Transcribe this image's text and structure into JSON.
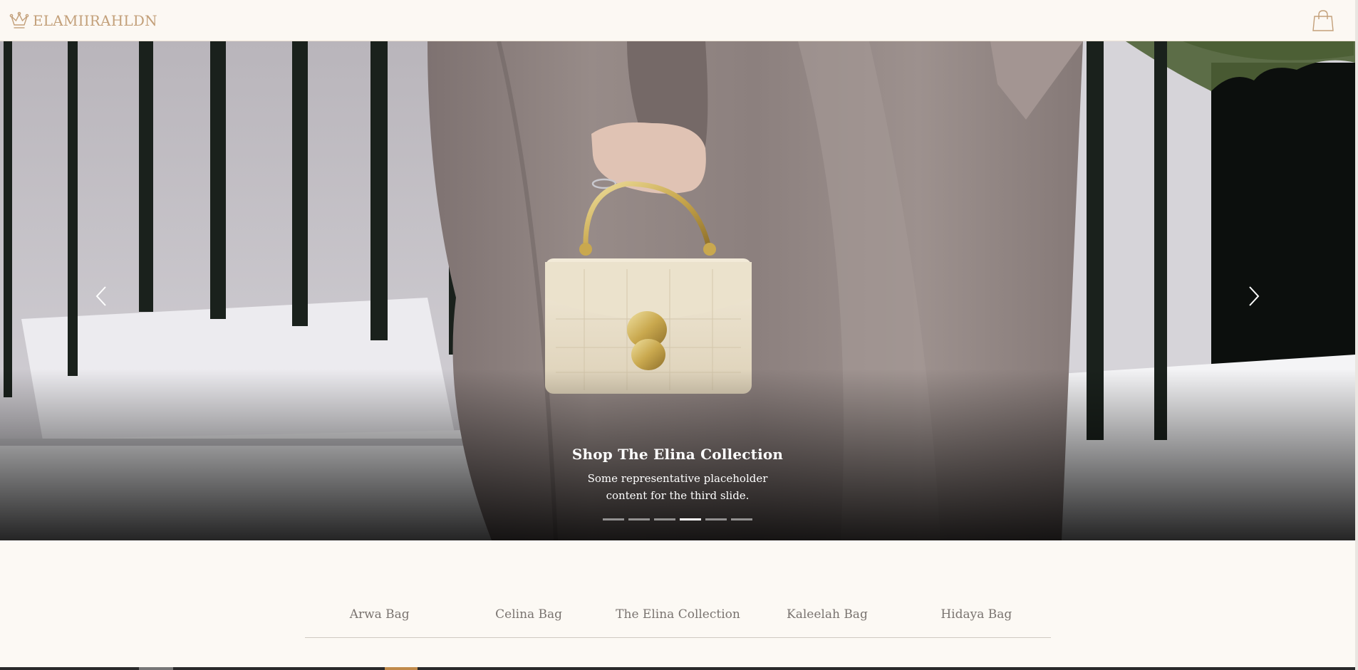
{
  "header": {
    "brand": "ELAMIIRAHLDN",
    "brand_icon": "crown-icon",
    "cart_icon": "shopping-bag-icon",
    "accent_color": "#c3a07a"
  },
  "carousel": {
    "slide_title": "Shop The Elina Collection",
    "slide_text": "Some representative placeholder content for the third slide.",
    "indicator_count": 6,
    "active_indicator": 4,
    "prev_icon": "chevron-left-icon",
    "next_icon": "chevron-right-icon"
  },
  "collections": {
    "items": [
      {
        "label": "Arwa Bag"
      },
      {
        "label": "Celina Bag"
      },
      {
        "label": "The Elina Collection"
      },
      {
        "label": "Kaleelah Bag"
      },
      {
        "label": "Hidaya Bag"
      }
    ]
  }
}
